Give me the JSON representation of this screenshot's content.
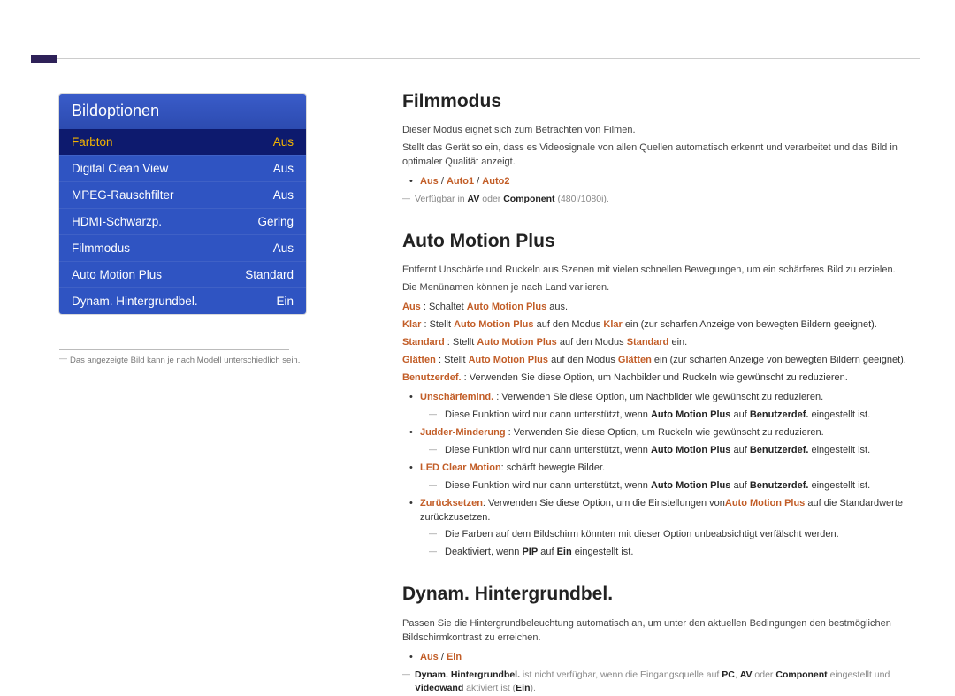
{
  "menu": {
    "title": "Bildoptionen",
    "items": [
      {
        "label": "Farbton",
        "value": "Aus",
        "selected": true
      },
      {
        "label": "Digital Clean View",
        "value": "Aus"
      },
      {
        "label": "MPEG-Rauschfilter",
        "value": "Aus"
      },
      {
        "label": "HDMI-Schwarzp.",
        "value": "Gering"
      },
      {
        "label": "Filmmodus",
        "value": "Aus"
      },
      {
        "label": "Auto Motion Plus",
        "value": "Standard"
      },
      {
        "label": "Dynam. Hintergrundbel.",
        "value": "Ein"
      }
    ],
    "note": "Das angezeigte Bild kann je nach Modell unterschiedlich sein."
  },
  "filmmodus": {
    "heading": "Filmmodus",
    "p1": "Dieser Modus eignet sich zum Betrachten von Filmen.",
    "p2": "Stellt das Gerät so ein, dass es Videosignale von allen Quellen automatisch erkennt und verarbeitet und das Bild in optimaler Qualität anzeigt.",
    "opts": {
      "a": "Aus",
      "b": "Auto1",
      "c": "Auto2"
    },
    "avail_pre": "Verfügbar in ",
    "avail_av": "AV",
    "avail_mid": " oder ",
    "avail_comp": "Component",
    "avail_post": " (480i/1080i)."
  },
  "amp": {
    "heading": "Auto Motion Plus",
    "p1": "Entfernt Unschärfe und Ruckeln aus Szenen mit vielen schnellen Bewegungen, um ein schärferes Bild zu erzielen.",
    "p2": "Die Menünamen können je nach Land variieren.",
    "d_aus": {
      "key": "Aus",
      "text": " : Schaltet ",
      "mid": "Auto Motion Plus",
      "post": " aus."
    },
    "d_klar": {
      "key": "Klar",
      "pre": " : Stellt ",
      "mid": "Auto Motion Plus",
      "mid2": " auf den Modus ",
      "k": "Klar",
      "post": " ein (zur scharfen Anzeige von bewegten Bildern geeignet)."
    },
    "d_std": {
      "key": "Standard",
      "pre": " : Stellt ",
      "mid": "Auto Motion Plus",
      "mid2": " auf den Modus ",
      "k": "Standard",
      "post": " ein."
    },
    "d_gl": {
      "key": "Glätten",
      "pre": " : Stellt ",
      "mid": "Auto Motion Plus",
      "mid2": " auf den Modus ",
      "k": "Glätten",
      "post": " ein (zur scharfen Anzeige von bewegten Bildern geeignet)."
    },
    "d_ben": {
      "key": "Benutzerdef.",
      "post": " : Verwenden Sie diese Option, um Nachbilder und Ruckeln wie gewünscht zu reduzieren."
    },
    "b_unsch": {
      "key": "Unschärfemind.",
      "post": " : Verwenden Sie diese Option, um Nachbilder wie gewünscht zu reduzieren."
    },
    "note_supp": {
      "pre": "Diese Funktion wird nur dann unterstützt, wenn ",
      "amp": "Auto Motion Plus",
      "mid": " auf ",
      "ben": "Benutzerdef.",
      "post": " eingestellt ist."
    },
    "b_judd": {
      "key": "Judder-Minderung",
      "post": " : Verwenden Sie diese Option, um Ruckeln wie gewünscht zu reduzieren."
    },
    "b_led": {
      "key": "LED Clear Motion",
      "post": ": schärft bewegte Bilder."
    },
    "b_zur": {
      "key": "Zurücksetzen",
      "post1": ": Verwenden Sie diese Option, um die Einstellungen von",
      "amp": "Auto Motion Plus",
      "post2": " auf die Standardwerte zurückzusetzen."
    },
    "note_color": "Die Farben auf dem Bildschirm könnten mit dieser Option unbeabsichtigt verfälscht werden.",
    "note_pip": {
      "pre": "Deaktiviert, wenn ",
      "pip": "PIP",
      "mid": " auf ",
      "ein": "Ein",
      "post": " eingestellt ist."
    }
  },
  "dyn": {
    "heading": "Dynam. Hintergrundbel.",
    "p1": "Passen Sie die Hintergrundbeleuchtung automatisch an, um unter den aktuellen Bedingungen den bestmöglichen Bildschirmkontrast zu erreichen.",
    "opts": {
      "a": "Aus",
      "b": "Ein"
    },
    "note": {
      "key": "Dynam. Hintergrundbel.",
      "pre": " ist nicht verfügbar, wenn die Eingangsquelle auf ",
      "pc": "PC",
      "c1": ", ",
      "av": "AV",
      "c2": " oder ",
      "comp": "Component",
      "mid": " eingestellt und ",
      "vw": "Videowand",
      "post1": " aktiviert ist (",
      "ein": "Ein",
      "post2": ")."
    }
  }
}
